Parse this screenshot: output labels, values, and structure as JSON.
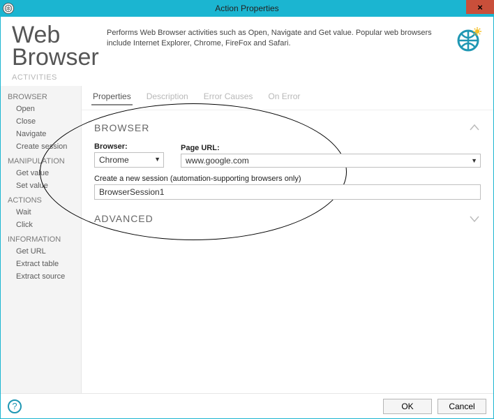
{
  "window": {
    "title": "Action Properties",
    "close_glyph": "×"
  },
  "header": {
    "title_line1": "Web",
    "title_line2": "Browser",
    "description": "Performs Web Browser activities such as Open, Navigate and Get value. Popular web browsers include Internet Explorer, Chrome, FireFox and Safari."
  },
  "labels": {
    "activities": "ACTIVITIES"
  },
  "sidebar": {
    "groups": [
      {
        "label": "BROWSER",
        "items": [
          "Open",
          "Close",
          "Navigate",
          "Create session"
        ]
      },
      {
        "label": "MANIPULATION",
        "items": [
          "Get value",
          "Set value"
        ]
      },
      {
        "label": "ACTIONS",
        "items": [
          "Wait",
          "Click"
        ]
      },
      {
        "label": "INFORMATION",
        "items": [
          "Get URL",
          "Extract table",
          "Extract source"
        ]
      }
    ]
  },
  "tabs": {
    "items": [
      "Properties",
      "Description",
      "Error Causes",
      "On Error"
    ],
    "active": 0
  },
  "section_browser": {
    "title": "BROWSER",
    "browser_label": "Browser:",
    "browser_value": "Chrome",
    "url_label": "Page URL:",
    "url_value": "www.google.com",
    "session_label": "Create a new session (automation-supporting browsers only)",
    "session_value": "BrowserSession1"
  },
  "section_advanced": {
    "title": "ADVANCED"
  },
  "footer": {
    "help_glyph": "?",
    "ok": "OK",
    "cancel": "Cancel"
  }
}
